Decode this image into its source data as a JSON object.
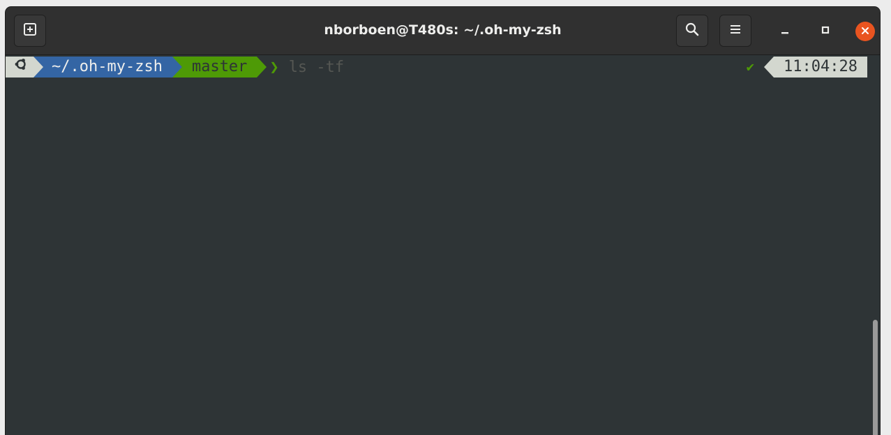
{
  "window": {
    "title": "nborboen@T480s: ~/.oh-my-zsh"
  },
  "headerbar": {
    "new_tab_icon": "new-tab-icon",
    "search_icon": "search-icon",
    "menu_icon": "hamburger-menu-icon",
    "minimize_icon": "minimize-icon",
    "maximize_icon": "maximize-icon",
    "close_icon": "close-icon"
  },
  "prompt": {
    "context_icon": "ubuntu-logo-icon",
    "directory": "~/.oh-my-zsh",
    "git_branch": "master",
    "prompt_char": "❯",
    "command": "ls -tf",
    "status_icon": "✔",
    "time": "11:04:28"
  },
  "colors": {
    "terminal_bg": "#2e3436",
    "headerbar_bg": "#303030",
    "context_bg": "#d3d7cf",
    "dir_bg": "#3465a4",
    "dir_fg": "#eeeeec",
    "git_bg": "#4e9a06",
    "git_fg": "#2e3436",
    "prompt_char": "#4e9a06",
    "status_ok": "#4e9a06",
    "close_button": "#e95420"
  }
}
